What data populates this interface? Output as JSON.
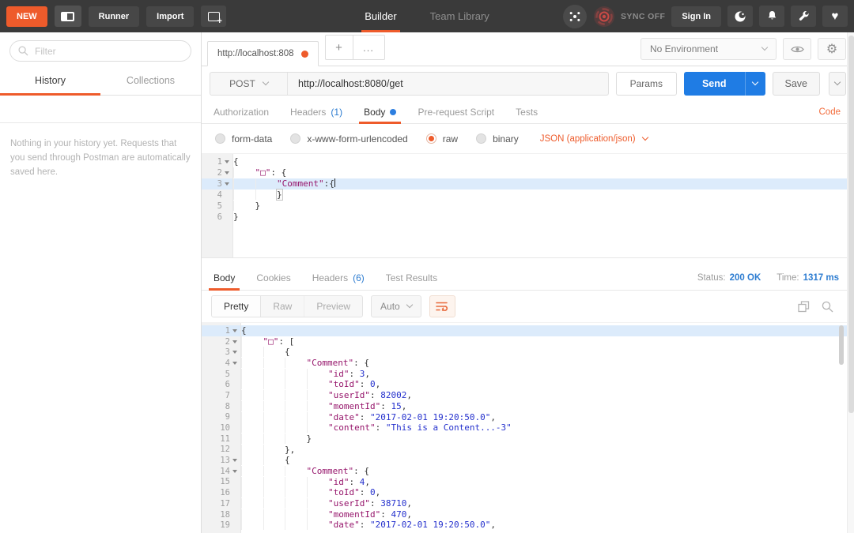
{
  "topbar": {
    "new_label": "NEW",
    "runner_label": "Runner",
    "import_label": "Import",
    "builder_tab": "Builder",
    "team_library_tab": "Team Library",
    "sync_label": "SYNC OFF",
    "signin_label": "Sign In"
  },
  "sidebar": {
    "filter_placeholder": "Filter",
    "history_tab": "History",
    "collections_tab": "Collections",
    "empty_text": "Nothing in your history yet. Requests that you send through Postman are automatically saved here."
  },
  "tabstrip": {
    "doc_tab": "http://localhost:808",
    "new_tab": "+",
    "more_tab": "...",
    "environment": "No Environment"
  },
  "request": {
    "method": "POST",
    "url": "http://localhost:8080/get",
    "params_label": "Params",
    "send_label": "Send",
    "save_label": "Save",
    "tabs": [
      {
        "label": "Authorization"
      },
      {
        "label": "Headers",
        "badge": "(1)"
      },
      {
        "label": "Body"
      },
      {
        "label": "Pre-request Script"
      },
      {
        "label": "Tests"
      }
    ],
    "code_link": "Code",
    "body_types": [
      "form-data",
      "x-www-form-urlencoded",
      "raw",
      "binary"
    ],
    "selected_body_type": "raw",
    "content_type": "JSON (application/json)"
  },
  "response": {
    "tabs": [
      {
        "label": "Body"
      },
      {
        "label": "Cookies"
      },
      {
        "label": "Headers",
        "badge": "(6)"
      },
      {
        "label": "Test Results"
      }
    ],
    "status_label": "Status:",
    "status_value": "200 OK",
    "time_label": "Time:",
    "time_value": "1317 ms",
    "view_modes": [
      "Pretty",
      "Raw",
      "Preview"
    ],
    "format_select": "Auto"
  },
  "editors": {
    "request": {
      "lines": [
        {
          "n": 1,
          "fold": true,
          "ind": 0,
          "toks": [
            [
              "{",
              "p"
            ]
          ]
        },
        {
          "n": 2,
          "fold": true,
          "ind": 1,
          "toks": [
            [
              "\"□\"",
              "k"
            ],
            [
              ": {",
              "p"
            ]
          ]
        },
        {
          "n": 3,
          "fold": true,
          "hl": true,
          "cur": true,
          "ind": 2,
          "toks": [
            [
              "\"Comment\"",
              "k"
            ],
            [
              ":{",
              "p"
            ]
          ]
        },
        {
          "n": 4,
          "ind": 2,
          "toks": [
            [
              "}",
              "mb"
            ]
          ]
        },
        {
          "n": 5,
          "ind": 1,
          "toks": [
            [
              "}",
              "p"
            ]
          ]
        },
        {
          "n": 6,
          "ind": 0,
          "toks": [
            [
              "}",
              "p"
            ]
          ]
        }
      ]
    },
    "response": {
      "lines": [
        {
          "n": 1,
          "fold": true,
          "hl": true,
          "ind": 0,
          "toks": [
            [
              "{",
              "p"
            ]
          ]
        },
        {
          "n": 2,
          "fold": true,
          "ind": 1,
          "toks": [
            [
              "\"□\"",
              "k"
            ],
            [
              ": [",
              "p"
            ]
          ]
        },
        {
          "n": 3,
          "fold": true,
          "ind": 2,
          "toks": [
            [
              "{",
              "p"
            ]
          ]
        },
        {
          "n": 4,
          "fold": true,
          "ind": 3,
          "toks": [
            [
              "\"Comment\"",
              "k"
            ],
            [
              ": {",
              "p"
            ]
          ]
        },
        {
          "n": 5,
          "ind": 4,
          "toks": [
            [
              "\"id\"",
              "k"
            ],
            [
              ": ",
              "p"
            ],
            [
              "3",
              "n"
            ],
            [
              ",",
              "p"
            ]
          ]
        },
        {
          "n": 6,
          "ind": 4,
          "toks": [
            [
              "\"toId\"",
              "k"
            ],
            [
              ": ",
              "p"
            ],
            [
              "0",
              "n"
            ],
            [
              ",",
              "p"
            ]
          ]
        },
        {
          "n": 7,
          "ind": 4,
          "toks": [
            [
              "\"userId\"",
              "k"
            ],
            [
              ": ",
              "p"
            ],
            [
              "82002",
              "n"
            ],
            [
              ",",
              "p"
            ]
          ]
        },
        {
          "n": 8,
          "ind": 4,
          "toks": [
            [
              "\"momentId\"",
              "k"
            ],
            [
              ": ",
              "p"
            ],
            [
              "15",
              "n"
            ],
            [
              ",",
              "p"
            ]
          ]
        },
        {
          "n": 9,
          "ind": 4,
          "toks": [
            [
              "\"date\"",
              "k"
            ],
            [
              ": ",
              "p"
            ],
            [
              "\"2017-02-01 19:20:50.0\"",
              "s"
            ],
            [
              ",",
              "p"
            ]
          ]
        },
        {
          "n": 10,
          "ind": 4,
          "toks": [
            [
              "\"content\"",
              "k"
            ],
            [
              ": ",
              "p"
            ],
            [
              "\"This is a Content...-3\"",
              "s"
            ]
          ]
        },
        {
          "n": 11,
          "ind": 3,
          "toks": [
            [
              "}",
              "p"
            ]
          ]
        },
        {
          "n": 12,
          "ind": 2,
          "toks": [
            [
              "},",
              "p"
            ]
          ]
        },
        {
          "n": 13,
          "fold": true,
          "ind": 2,
          "toks": [
            [
              "{",
              "p"
            ]
          ]
        },
        {
          "n": 14,
          "fold": true,
          "ind": 3,
          "toks": [
            [
              "\"Comment\"",
              "k"
            ],
            [
              ": {",
              "p"
            ]
          ]
        },
        {
          "n": 15,
          "ind": 4,
          "toks": [
            [
              "\"id\"",
              "k"
            ],
            [
              ": ",
              "p"
            ],
            [
              "4",
              "n"
            ],
            [
              ",",
              "p"
            ]
          ]
        },
        {
          "n": 16,
          "ind": 4,
          "toks": [
            [
              "\"toId\"",
              "k"
            ],
            [
              ": ",
              "p"
            ],
            [
              "0",
              "n"
            ],
            [
              ",",
              "p"
            ]
          ]
        },
        {
          "n": 17,
          "ind": 4,
          "toks": [
            [
              "\"userId\"",
              "k"
            ],
            [
              ": ",
              "p"
            ],
            [
              "38710",
              "n"
            ],
            [
              ",",
              "p"
            ]
          ]
        },
        {
          "n": 18,
          "ind": 4,
          "toks": [
            [
              "\"momentId\"",
              "k"
            ],
            [
              ": ",
              "p"
            ],
            [
              "470",
              "n"
            ],
            [
              ",",
              "p"
            ]
          ]
        },
        {
          "n": 19,
          "ind": 4,
          "toks": [
            [
              "\"date\"",
              "k"
            ],
            [
              ": ",
              "p"
            ],
            [
              "\"2017-02-01 19:20:50.0\"",
              "s"
            ],
            [
              ",",
              "p"
            ]
          ]
        }
      ]
    }
  },
  "colors": {
    "orange": "#ee5b2b",
    "send_blue": "#1f7ce4",
    "link_blue": "#2e7dd1",
    "topbar_bg": "#3a3a3a"
  }
}
